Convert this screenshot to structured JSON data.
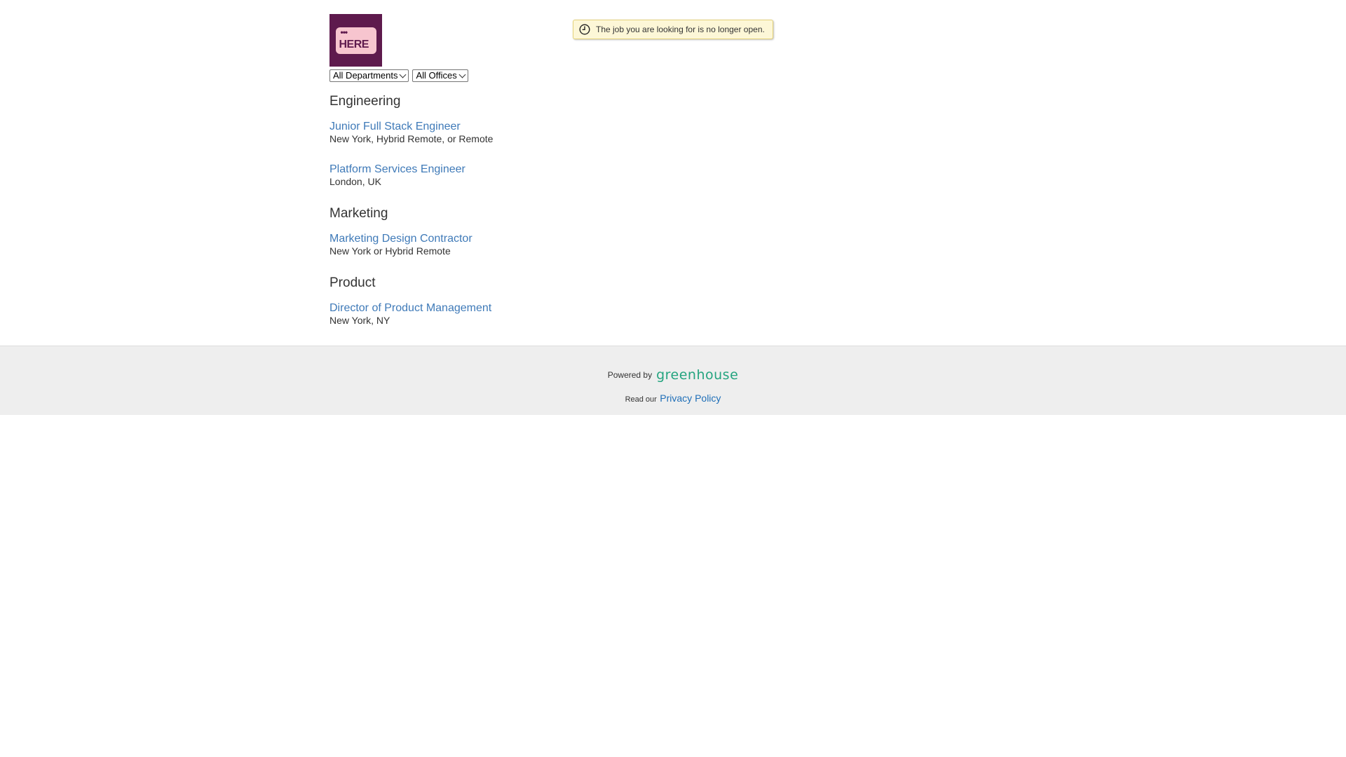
{
  "logo": {
    "dots": "•••",
    "text": "HERE"
  },
  "filters": {
    "departments": "All Departments",
    "offices": "All Offices"
  },
  "notice": {
    "icon": "clock-icon",
    "message": "The job you are looking for is no longer open."
  },
  "sections": [
    {
      "title": "Engineering",
      "jobs": [
        {
          "title": "Junior Full Stack Engineer",
          "location": "New York, Hybrid Remote, or Remote"
        },
        {
          "title": "Platform Services Engineer",
          "location": "London, UK"
        }
      ]
    },
    {
      "title": "Marketing",
      "jobs": [
        {
          "title": "Marketing Design Contractor",
          "location": "New York or Hybrid Remote"
        }
      ]
    },
    {
      "title": "Product",
      "jobs": [
        {
          "title": "Director of Product Management",
          "location": "New York, NY"
        }
      ]
    }
  ],
  "footer": {
    "powered_by": "Powered by",
    "brand": "greenhouse",
    "read_our": "Read our",
    "privacy_link": "Privacy Policy"
  },
  "colors": {
    "link": "#3f7ab8",
    "logo_bg": "#5e1a4d",
    "brand_green": "#24a47f",
    "notice_bg": "#fdf7d7"
  }
}
